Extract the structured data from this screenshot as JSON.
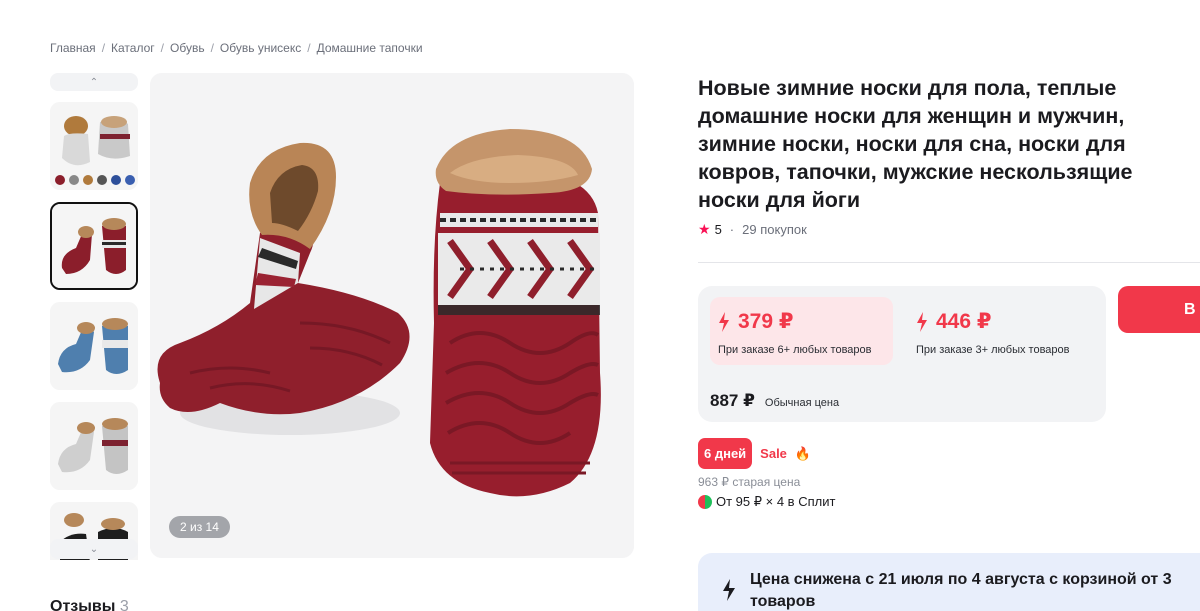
{
  "breadcrumb": [
    {
      "label": "Главная"
    },
    {
      "label": "Каталог"
    },
    {
      "label": "Обувь"
    },
    {
      "label": "Обувь унисекс"
    },
    {
      "label": "Домашние тапочки"
    }
  ],
  "breadcrumb_separator": "/",
  "gallery": {
    "up_icon": "chevron-up-icon",
    "down_icon": "chevron-down-icon",
    "up_glyph": "⌃",
    "down_glyph": "⌄",
    "counter": "2 из 14",
    "thumbnail_colors": [
      "#7a7f86",
      "#8b1e2b",
      "#4f7fae",
      "#b8b8b8",
      "#1a1a1a"
    ],
    "active_index": 1
  },
  "product": {
    "title": "Новые зимние носки для пола, теплые домашние носки для женщин и мужчин, зимние носки, носки для сна, носки для ковров, тапочки, мужские нескользящие носки для йоги",
    "rating": "5",
    "rating_separator": "·",
    "purchases": "29 покупок"
  },
  "pricing": {
    "tier1_price": "379 ₽",
    "tier1_note": "При заказе 6+ любых товаров",
    "tier2_price": "446 ₽",
    "tier2_note": "При заказе 3+ любых товаров",
    "regular_price": "887 ₽",
    "regular_label": "Обычная цена",
    "buy_label": "В"
  },
  "sale": {
    "days_badge": "6 дней",
    "sale_label": "Sale",
    "fire_glyph": "🔥",
    "old_price": "963 ₽ старая цена",
    "split_text": "От 95 ₽ × 4 в Сплит"
  },
  "promo": {
    "text": "Цена снижена с 21 июля по 4 августа с корзиной от 3 товаров"
  },
  "reviews": {
    "label": "Отзывы",
    "count": "3"
  },
  "colors": {
    "accent_red": "#f1384a",
    "tier_highlight": "#fde6e9",
    "card_bg": "#f2f3f5",
    "promo_bg": "#e8eefb"
  }
}
